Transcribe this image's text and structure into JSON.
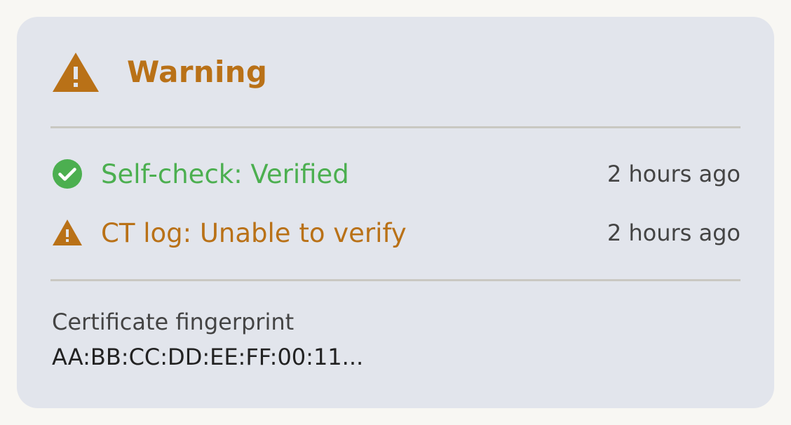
{
  "colors": {
    "warning": "#b97117",
    "success": "#4caf50",
    "card_background": "#e2e5ec",
    "page_background": "#f8f7f3"
  },
  "header": {
    "icon": "warning-triangle-icon",
    "title": "Warning"
  },
  "checks": [
    {
      "icon": "check-circle-icon",
      "status": "success",
      "label": "Self-check: Verified",
      "time": "2 hours ago"
    },
    {
      "icon": "warning-triangle-icon",
      "status": "warning",
      "label": "CT log: Unable to verify",
      "time": "2 hours ago"
    }
  ],
  "fingerprint": {
    "label": "Certificate fingerprint",
    "value": "AA:BB:CC:DD:EE:FF:00:11..."
  }
}
